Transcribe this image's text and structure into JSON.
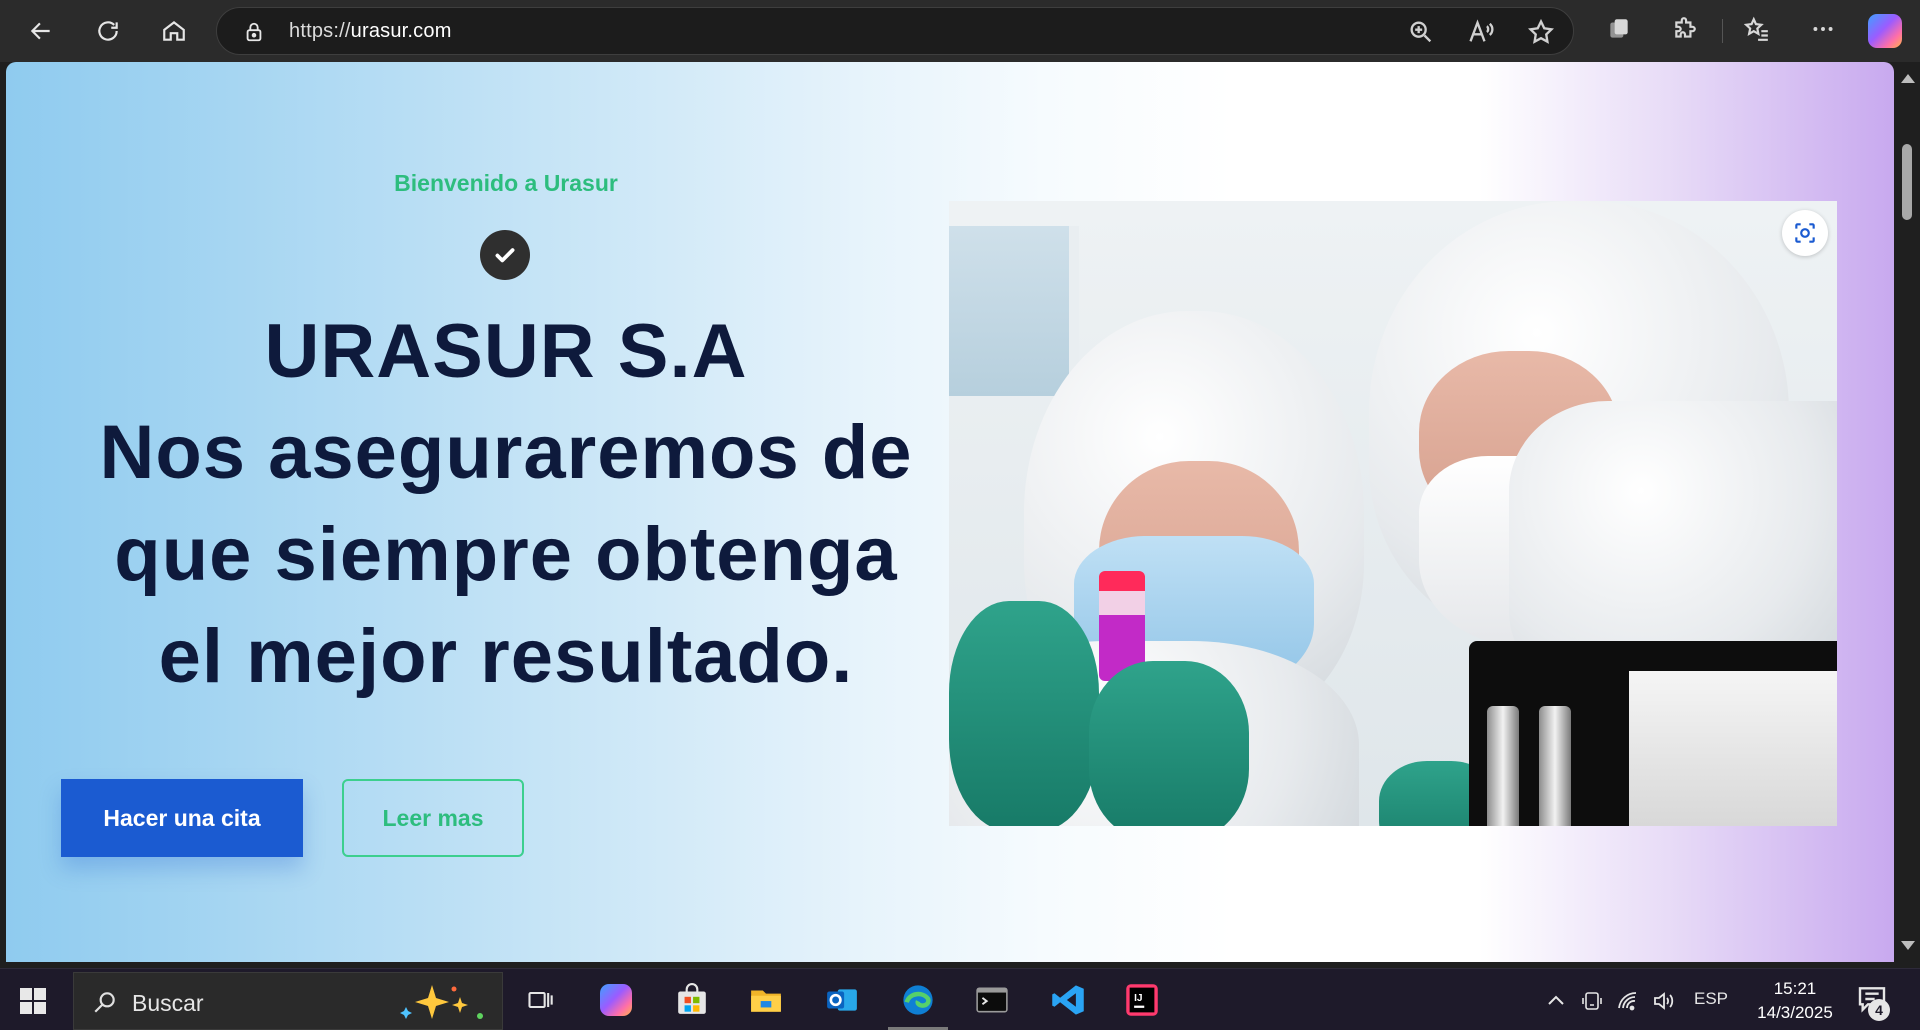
{
  "browser": {
    "url_prefix": "https://",
    "url_domain": "urasur.com"
  },
  "hero": {
    "welcome": "Bienvenido a Urasur",
    "title_line1": "URASUR S.A",
    "title_line2": "Nos aseguraremos de",
    "title_line3": "que siempre obtenga",
    "title_line4": "el mejor resultado.",
    "primary_button": "Hacer una cita",
    "secondary_button": "Leer mas",
    "accent_color": "#2dbd7e",
    "primary_color": "#1b5bd1",
    "heading_color": "#0e1a3c"
  },
  "taskbar": {
    "search_placeholder": "Buscar",
    "language": "ESP",
    "time": "15:21",
    "date": "14/3/2025",
    "notification_count": "4"
  }
}
